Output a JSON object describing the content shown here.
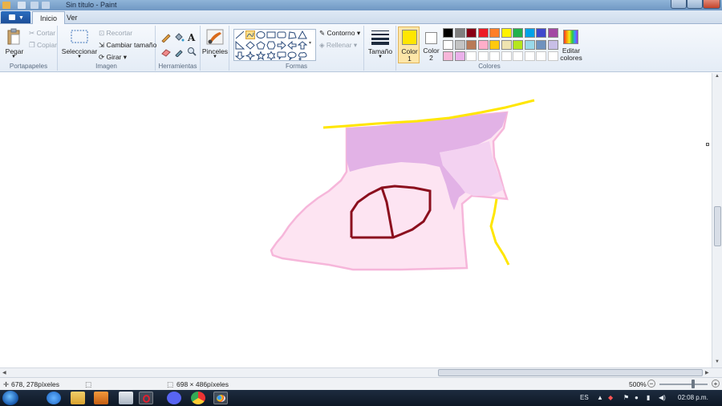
{
  "window": {
    "title": "Sin título - Paint"
  },
  "tabs": [
    {
      "label": "Inicio",
      "active": true
    },
    {
      "label": "Ver",
      "active": false
    }
  ],
  "groups": {
    "portapapeles": {
      "label": "Portapapeles",
      "paste": "Pegar",
      "cut": "Cortar",
      "copy": "Copiar"
    },
    "imagen": {
      "label": "Imagen",
      "select": "Seleccionar",
      "crop": "Recortar",
      "resize": "Cambiar tamaño",
      "rotate": "Girar"
    },
    "herramientas": {
      "label": "Herramientas"
    },
    "pinceles": {
      "label": "Pinceles"
    },
    "formas": {
      "label": "Formas",
      "outline": "Contorno",
      "fill": "Rellenar"
    },
    "tamano": {
      "label": "Tamaño"
    },
    "colores": {
      "label": "Colores",
      "color1_a": "Color",
      "color1_b": "1",
      "color2_a": "Color",
      "color2_b": "2",
      "edit_a": "Editar",
      "edit_b": "colores",
      "color1_value": "#ffe600",
      "color2_value": "#ffffff",
      "palette_row1": [
        "#000000",
        "#7f7f7f",
        "#880015",
        "#ed1c24",
        "#ff7f27",
        "#fff200",
        "#22b14c",
        "#00a2e8",
        "#3f48cc",
        "#a349a4"
      ],
      "palette_row2": [
        "#ffffff",
        "#c3c3c3",
        "#b97a57",
        "#ffaec9",
        "#ffc90e",
        "#efe4b0",
        "#b5e61d",
        "#99d9ea",
        "#7092be",
        "#c8bfe7"
      ],
      "palette_row3": [
        "#f7b6d9",
        "#eab0ea",
        "#ffffff",
        "#ffffff",
        "#ffffff",
        "#ffffff",
        "#ffffff",
        "#ffffff",
        "#ffffff",
        "#ffffff"
      ]
    }
  },
  "status": {
    "cursor_pos": "678, 278píxeles",
    "image_size": "698 × 486píxeles",
    "zoom": "500%"
  },
  "taskbar": {
    "language": "ES",
    "clock": "02:08 p.m."
  }
}
